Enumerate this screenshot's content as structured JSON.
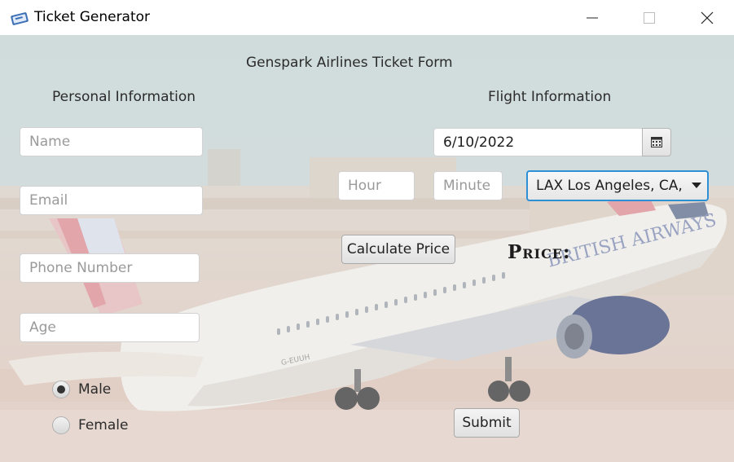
{
  "window": {
    "title": "Ticket Generator"
  },
  "form": {
    "heading": "Genspark Airlines Ticket Form",
    "personal_header": "Personal Information",
    "flight_header": "Flight Information",
    "name_placeholder": "Name",
    "email_placeholder": "Email",
    "phone_placeholder": "Phone Number",
    "age_placeholder": "Age",
    "gender_options": [
      {
        "label": "Male",
        "selected": true
      },
      {
        "label": "Female",
        "selected": false
      }
    ],
    "date_value": "6/10/2022",
    "hour_placeholder": "Hour",
    "minute_placeholder": "Minute",
    "destination_selected": "LAX Los Angeles, CA, B...",
    "calculate_label": "Calculate Price",
    "price_label": "Price:",
    "submit_label": "Submit"
  },
  "icons": {
    "app": "ticket-icon",
    "date_picker": "calendar-icon",
    "dropdown": "chevron-down-icon"
  },
  "colors": {
    "focus_accent": "#2d8fd6",
    "text": "#2b2b2b",
    "placeholder": "#9a9a9a"
  }
}
